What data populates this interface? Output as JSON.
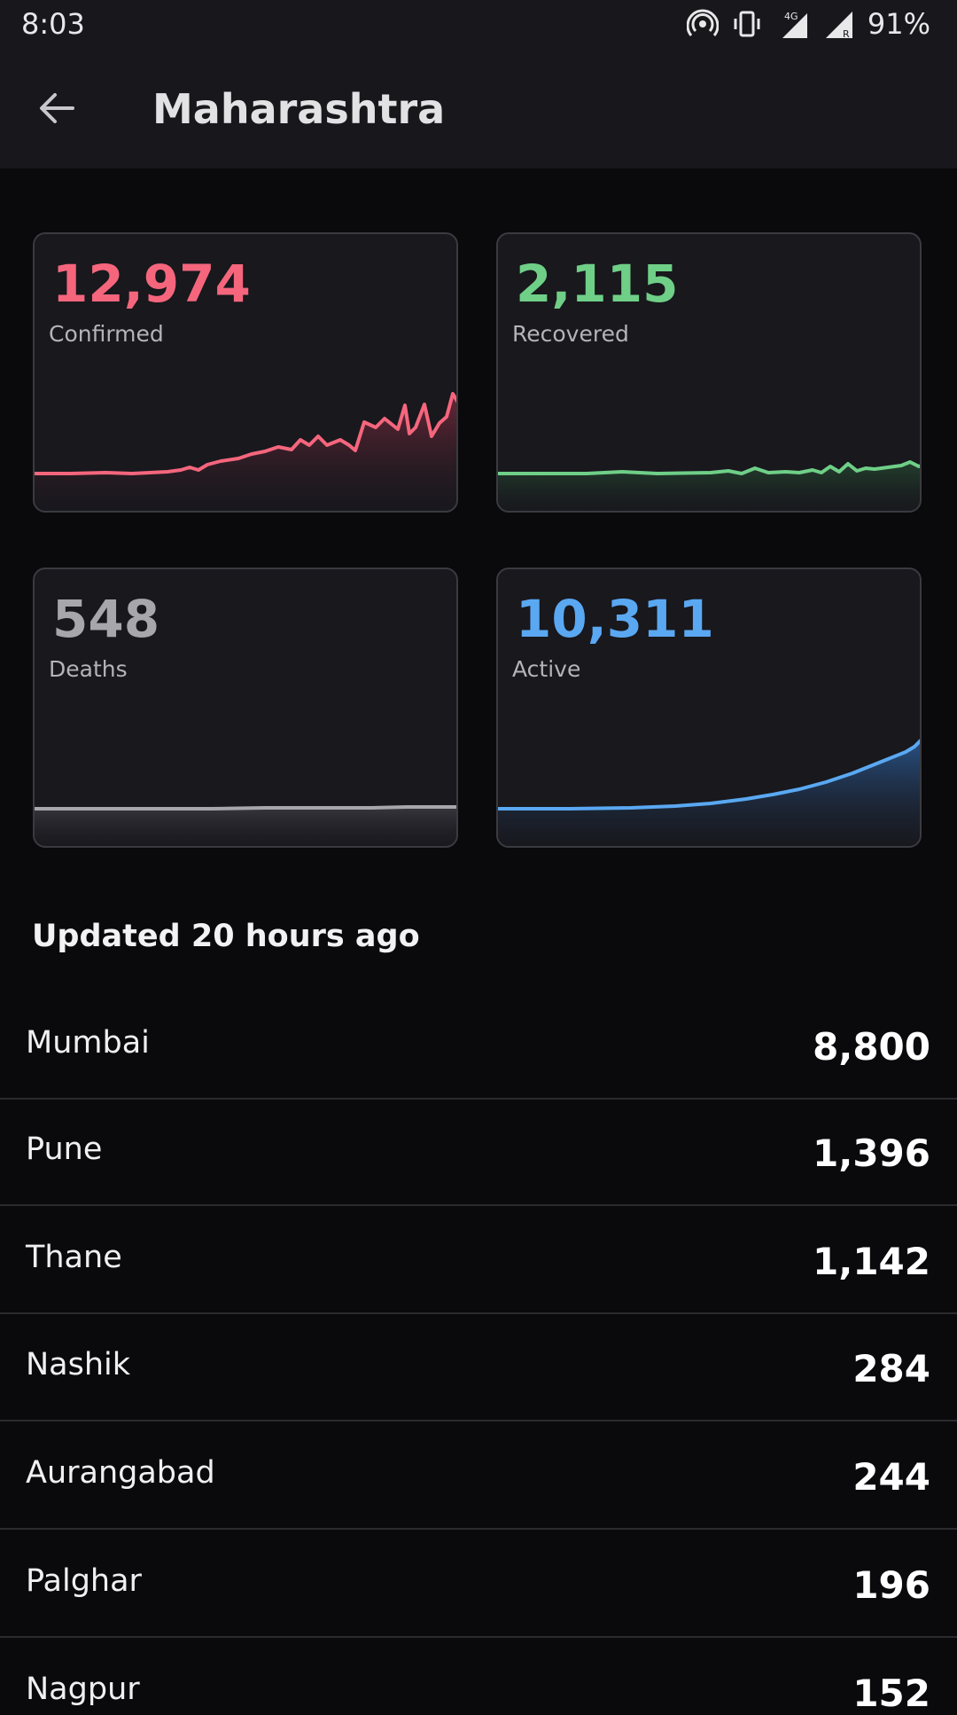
{
  "status_bar": {
    "time": "8:03",
    "battery": "91%",
    "network": "4G",
    "icons": [
      "hotspot-icon",
      "vibrate-icon",
      "signal-icon",
      "roaming-signal-icon"
    ]
  },
  "app_bar": {
    "back_icon": "arrow-left-icon",
    "title": "Maharashtra"
  },
  "cards": [
    {
      "value": "12,974",
      "label": "Confirmed",
      "color": "#f5667d",
      "fill": "#6b2a38"
    },
    {
      "value": "2,115",
      "label": "Recovered",
      "color": "#6fcf87",
      "fill": "#1f3b2a"
    },
    {
      "value": "548",
      "label": "Deaths",
      "color": "#a6a6ab",
      "fill": "#33333a"
    },
    {
      "value": "10,311",
      "label": "Active",
      "color": "#5aa8f2",
      "fill": "#244a7a"
    }
  ],
  "updated": "Updated 20 hours ago",
  "districts": [
    {
      "name": "Mumbai",
      "count": "8,800"
    },
    {
      "name": "Pune",
      "count": "1,396"
    },
    {
      "name": "Thane",
      "count": "1,142"
    },
    {
      "name": "Nashik",
      "count": "284"
    },
    {
      "name": "Aurangabad",
      "count": "244"
    },
    {
      "name": "Palghar",
      "count": "196"
    },
    {
      "name": "Nagpur",
      "count": "152"
    }
  ]
}
